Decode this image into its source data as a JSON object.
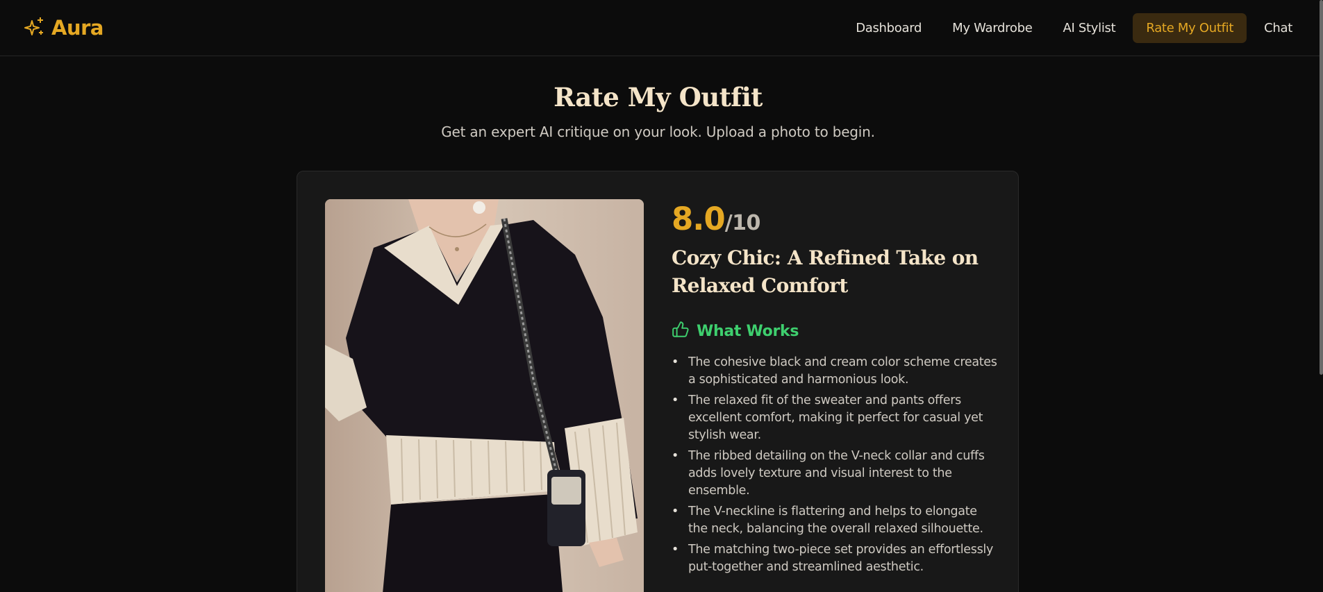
{
  "brand": {
    "name": "Aura",
    "icon": "sparkles-icon",
    "color": "#e5a823"
  },
  "nav": {
    "items": [
      {
        "label": "Dashboard",
        "active": false
      },
      {
        "label": "My Wardrobe",
        "active": false
      },
      {
        "label": "AI Stylist",
        "active": false
      },
      {
        "label": "Rate My Outfit",
        "active": true
      },
      {
        "label": "Chat",
        "active": false
      }
    ]
  },
  "page": {
    "title": "Rate My Outfit",
    "subtitle": "Get an expert AI critique on your look. Upload a photo to begin."
  },
  "result": {
    "score": "8.0",
    "score_max": "/10",
    "title": "Cozy Chic: A Refined Take on Relaxed Comfort",
    "what_works": {
      "heading": "What Works",
      "icon": "thumbs-up-icon",
      "items": [
        "The cohesive black and cream color scheme creates a sophisticated and harmonious look.",
        "The relaxed fit of the sweater and pants offers excellent comfort, making it perfect for casual yet stylish wear.",
        "The ribbed detailing on the V-neck collar and cuffs adds lovely texture and visual interest to the ensemble.",
        "The V-neckline is flattering and helps to elongate the neck, balancing the overall relaxed silhouette.",
        "The matching two-piece set provides an effortlessly put-together and streamlined aesthetic."
      ]
    }
  },
  "colors": {
    "accent": "#e5a823",
    "success": "#3ecf6e",
    "background": "#0c0c0c",
    "card": "#181818"
  }
}
